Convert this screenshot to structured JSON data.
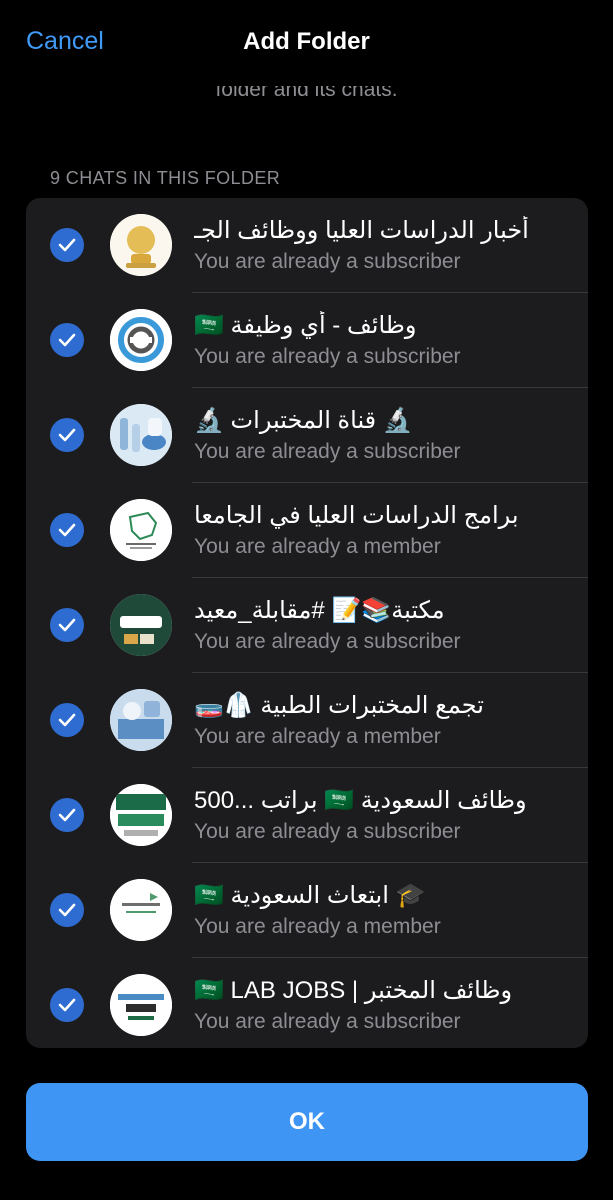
{
  "nav": {
    "cancel_label": "Cancel",
    "title": "Add Folder"
  },
  "description_fragment": "folder and its chats.",
  "section_header": "9 CHATS IN THIS FOLDER",
  "chats": [
    {
      "name": "أخبار الدراسات العليا ووظائف الجـ",
      "status": "You are already a subscriber",
      "checked": true,
      "avatar": "gold-trophy-icon"
    },
    {
      "name": "وظائف - أي وظيفة 🇸🇦",
      "status": "You are already a subscriber",
      "checked": true,
      "avatar": "handshake-logo-icon"
    },
    {
      "name": "🔬 قناة المختبرات 🔬",
      "status": "You are already a subscriber",
      "checked": true,
      "avatar": "lab-photo-icon"
    },
    {
      "name": "برامج الدراسات العليا في الجامعا",
      "status": "You are already a member",
      "checked": true,
      "avatar": "saudi-map-logo-icon"
    },
    {
      "name": "مكتبة📚📝 #مقابلة_معيد",
      "status": "You are already a subscriber",
      "checked": true,
      "avatar": "moeed-logo-icon"
    },
    {
      "name": "تجمع المختبرات الطبية 🥼🧫",
      "status": "You are already a member",
      "checked": true,
      "avatar": "lab-photo-icon"
    },
    {
      "name": "وظائف السعودية 🇸🇦 براتب ...500",
      "status": "You are already a subscriber",
      "checked": true,
      "avatar": "saudi-jobs-logo-icon"
    },
    {
      "name": "🎓 ابتعاث السعودية 🇸🇦",
      "status": "You are already a member",
      "checked": true,
      "avatar": "scholarship-logo-icon"
    },
    {
      "name": "وظائف المختبر | 🇸🇦 LAB JOBS",
      "status": "You are already a subscriber",
      "checked": true,
      "avatar": "laboratory-jobs-logo-icon"
    }
  ],
  "ok_label": "OK",
  "colors": {
    "accent": "#3f9bf7",
    "check": "#2f6cd1",
    "button": "#3e95f4",
    "panel": "#1c1c1e"
  }
}
